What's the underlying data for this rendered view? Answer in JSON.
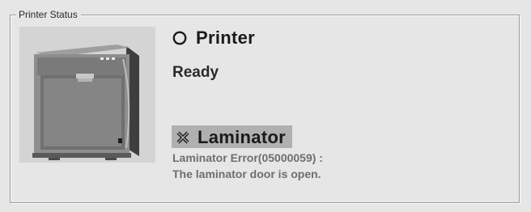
{
  "group": {
    "title": "Printer Status"
  },
  "printer": {
    "name": "Printer",
    "status": "Ready",
    "status_icon": "circle-ok-icon"
  },
  "laminator": {
    "name": "Laminator",
    "status_icon": "x-error-icon",
    "message_line1": "Laminator Error(05000059) :",
    "message_line2": "The laminator door is open."
  },
  "colors": {
    "background": "#e6e6e6",
    "highlight": "#b0b0b0",
    "error_text": "#6e6e6e"
  }
}
